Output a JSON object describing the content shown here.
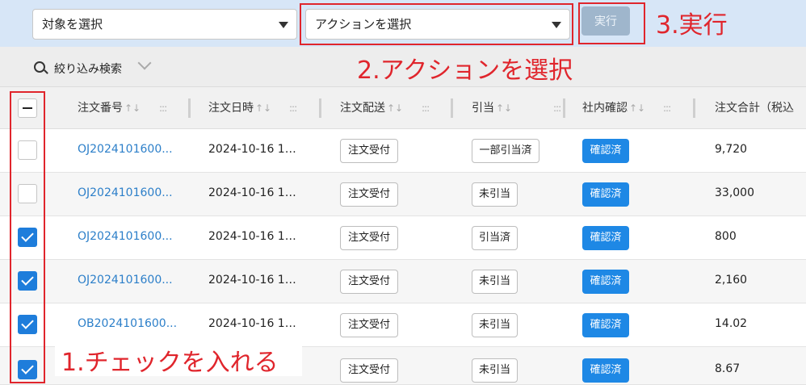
{
  "toolbar": {
    "target_select": "対象を選択",
    "action_select": "アクションを選択",
    "execute_label": "実行"
  },
  "filter": {
    "label": "絞り込み検索"
  },
  "table": {
    "columns": [
      "注文番号",
      "注文日時",
      "注文配送",
      "引当",
      "社内確認",
      "注文合計（税込"
    ],
    "sort_icon": "↑↓",
    "dots_icon": ":::",
    "rows": [
      {
        "checked": false,
        "order_no": "OJ2024101600...",
        "date": "2024-10-16 1…",
        "shipping": "注文受付",
        "allocation": "一部引当済",
        "confirm": "確認済",
        "total": "9,720"
      },
      {
        "checked": false,
        "order_no": "OJ2024101600...",
        "date": "2024-10-16 1…",
        "shipping": "注文受付",
        "allocation": "未引当",
        "confirm": "確認済",
        "total": "33,000"
      },
      {
        "checked": true,
        "order_no": "OJ2024101600...",
        "date": "2024-10-16 1…",
        "shipping": "注文受付",
        "allocation": "引当済",
        "confirm": "確認済",
        "total": "800"
      },
      {
        "checked": true,
        "order_no": "OJ2024101600...",
        "date": "2024-10-16 1…",
        "shipping": "注文受付",
        "allocation": "未引当",
        "confirm": "確認済",
        "total": "2,160"
      },
      {
        "checked": true,
        "order_no": "OB2024101600...",
        "date": "2024-10-16 1…",
        "shipping": "注文受付",
        "allocation": "未引当",
        "confirm": "確認済",
        "total": "14.02"
      },
      {
        "checked": true,
        "order_no": "",
        "date": "",
        "shipping": "注文受付",
        "allocation": "未引当",
        "confirm": "確認済",
        "total": "8.67"
      }
    ]
  },
  "annotations": {
    "step1": "1.チェックを入れる",
    "step2": "2.アクションを選択",
    "step3": "3.実行",
    "color": "#e0252c"
  },
  "colors": {
    "topbar_bg": "#d7e6f7",
    "accent_blue": "#1e88e5",
    "link_blue": "#2c7fc9",
    "execute_disabled": "#9fb6cc"
  }
}
